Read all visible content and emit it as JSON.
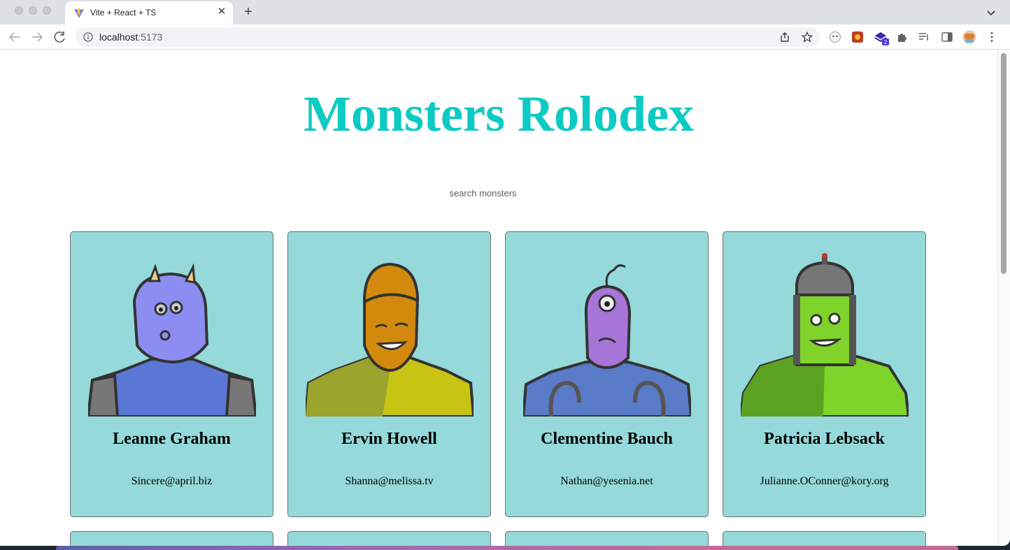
{
  "browser": {
    "tab": {
      "title": "Vite + React + TS",
      "close_glyph": "✕"
    },
    "new_tab_glyph": "+",
    "address": {
      "host": "localhost",
      "port": ":5173"
    },
    "extensions": {
      "badge_count": "2"
    }
  },
  "page": {
    "title": "Monsters Rolodex",
    "search": {
      "placeholder": "search monsters",
      "value": ""
    },
    "monsters": [
      {
        "name": "Leanne Graham",
        "email": "Sincere@april.biz",
        "color": "#8b8ef0"
      },
      {
        "name": "Ervin Howell",
        "email": "Shanna@melissa.tv",
        "color": "#d08b10"
      },
      {
        "name": "Clementine Bauch",
        "email": "Nathan@yesenia.net",
        "color": "#a774d8"
      },
      {
        "name": "Patricia Lebsack",
        "email": "Julianne.OConner@kory.org",
        "color": "#7fd32a"
      }
    ]
  },
  "colors": {
    "title": "#0ccac4",
    "card_bg": "#95d9da",
    "card_border": "#707070"
  }
}
